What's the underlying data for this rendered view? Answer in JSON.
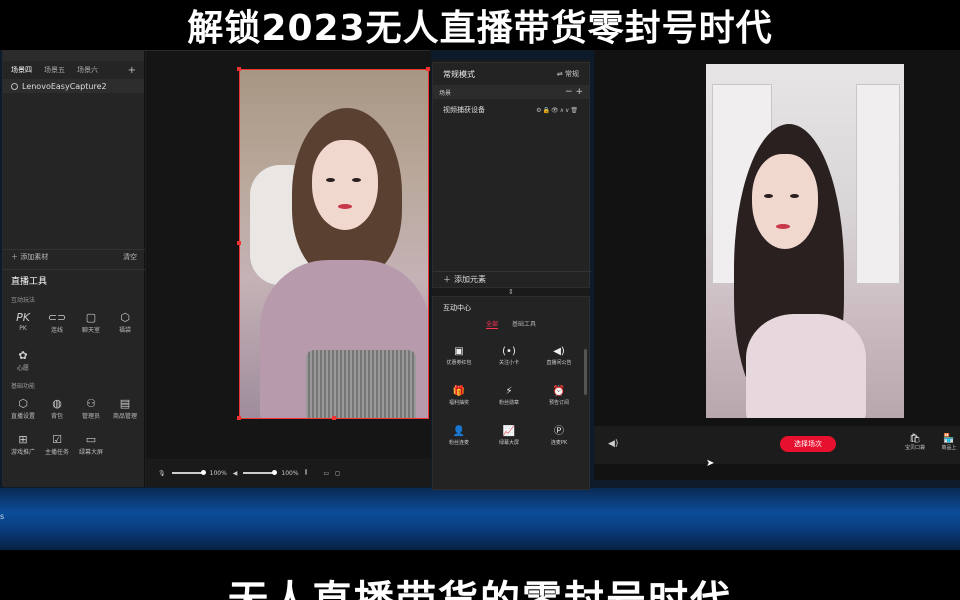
{
  "captions": {
    "top": "解锁2023无人直播带货零封号时代",
    "bottom": "无人直播带货的零封号时代"
  },
  "left_panel": {
    "scene_tabs": [
      "场景四",
      "场景五",
      "场景六"
    ],
    "source_item": "LenovoEasyCapture2",
    "add_material": "添加素材",
    "clear": "清空",
    "tools_title": "直播工具",
    "interactive_section": "互动玩法",
    "interactive_tools": [
      {
        "label": "PK",
        "icon": "pk-icon"
      },
      {
        "label": "连线",
        "icon": "link-icon"
      },
      {
        "label": "聊天室",
        "icon": "chatroom-icon"
      },
      {
        "label": "福袋",
        "icon": "lucky-bag-icon"
      },
      {
        "label": "心愿",
        "icon": "wish-icon"
      }
    ],
    "basic_section": "基础功能",
    "basic_tools": [
      {
        "label": "直播设置",
        "icon": "settings-icon"
      },
      {
        "label": "背包",
        "icon": "backpack-icon"
      },
      {
        "label": "管理员",
        "icon": "admin-icon"
      },
      {
        "label": "商品管理",
        "icon": "goods-icon"
      },
      {
        "label": "游戏推广",
        "icon": "gamepad-icon"
      },
      {
        "label": "主播任务",
        "icon": "task-icon"
      },
      {
        "label": "绿幕大屏",
        "icon": "screen-icon"
      }
    ]
  },
  "preview_controls": {
    "mic_volume": "100%",
    "speaker_volume": "100%"
  },
  "middle_panel": {
    "mode_title": "常规模式",
    "mode_switch": "⇌ 常规",
    "scene_label": "场景",
    "video_device": "视频捕获设备",
    "add_element": "添加元素",
    "interaction_center": "互动中心",
    "tabs": [
      "全部",
      "基础工具"
    ],
    "active_tab": "全部",
    "grid": [
      {
        "label": "优惠券红包",
        "icon": "coupon-icon"
      },
      {
        "label": "关注小卡",
        "icon": "follow-card-icon"
      },
      {
        "label": "直播间公告",
        "icon": "announcement-icon"
      },
      {
        "label": "福利抽奖",
        "icon": "gift-icon"
      },
      {
        "label": "粉丝勋章",
        "icon": "badge-icon"
      },
      {
        "label": "预告订阅",
        "icon": "subscribe-icon"
      },
      {
        "label": "粉丝连麦",
        "icon": "fans-connect-icon"
      },
      {
        "label": "绿幕大屏",
        "icon": "chart-icon"
      },
      {
        "label": "连麦PK",
        "icon": "pk-icon"
      }
    ]
  },
  "right_panel": {
    "select_scene_button": "选择场次",
    "bottom_buttons": [
      {
        "label": "宝贝口袋",
        "icon": "bag-icon"
      },
      {
        "label": "商品上",
        "icon": "shop-icon"
      }
    ]
  },
  "colors": {
    "accent": "#e8102f",
    "selection": "#ee3333"
  }
}
